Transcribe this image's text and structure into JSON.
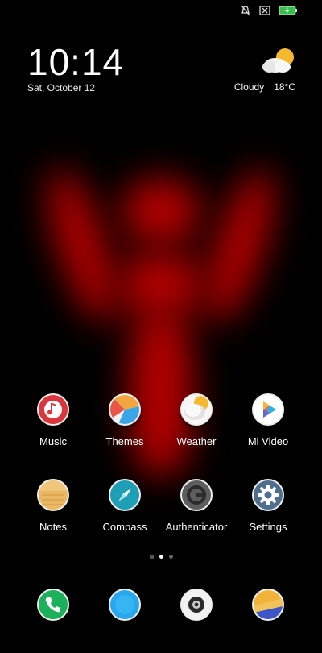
{
  "status_bar": {
    "icons": [
      "mute-icon",
      "no-sim-icon",
      "battery-charging-icon"
    ]
  },
  "lockscreen": {
    "time": "10:14",
    "date": "Sat, October 12"
  },
  "weather": {
    "condition": "Cloudy",
    "temperature": "18°C",
    "icon": "partly-cloudy-icon"
  },
  "apps_row1": [
    {
      "label": "Music",
      "icon": "music-icon"
    },
    {
      "label": "Themes",
      "icon": "themes-icon"
    },
    {
      "label": "Weather",
      "icon": "weather-icon"
    },
    {
      "label": "Mi Video",
      "icon": "play-icon"
    }
  ],
  "apps_row2": [
    {
      "label": "Notes",
      "icon": "notes-icon"
    },
    {
      "label": "Compass",
      "icon": "compass-icon"
    },
    {
      "label": "Authenticator",
      "icon": "authenticator-icon"
    },
    {
      "label": "Settings",
      "icon": "gear-icon"
    }
  ],
  "dock": [
    {
      "icon": "phone-icon"
    },
    {
      "icon": "messages-icon"
    },
    {
      "icon": "camera-icon"
    },
    {
      "icon": "gallery-icon"
    }
  ],
  "page_indicator": {
    "pages": 3,
    "current": 2
  }
}
